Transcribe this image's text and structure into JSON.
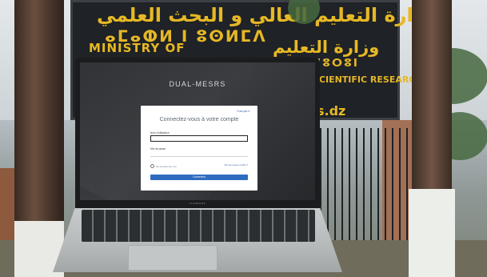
{
  "sign": {
    "arabic_line1": "وزارة التعليم العالي و البحث العلمي",
    "tifinagh_line": "ⴰⵎⴰⵀⵍ ⵏ ⵓⵙⵍⵎⴷ",
    "english_line": "MINISTRY OF",
    "arabic_line2": "وزارة التعليم",
    "tifinagh_line2": "ⵏⵓⵔⵓⵏ",
    "english_line2": "SCIENTIFIC RESEARCH",
    "domain_fragment": "s.dz"
  },
  "laptop": {
    "brand_label": "VIVOBOOK"
  },
  "screen": {
    "app_title": "DUAL-MESRS"
  },
  "login": {
    "language_selector": "Français ▾",
    "heading": "Connectez-vous à votre compte",
    "username_label": "Nom d'utilisateur",
    "username_value": "",
    "password_label": "Mot de passe",
    "password_value": "",
    "remember_label": "Se souvenir de moi",
    "forgot_link": "Mot de passe oublié ?",
    "submit_label": "Connexion"
  }
}
